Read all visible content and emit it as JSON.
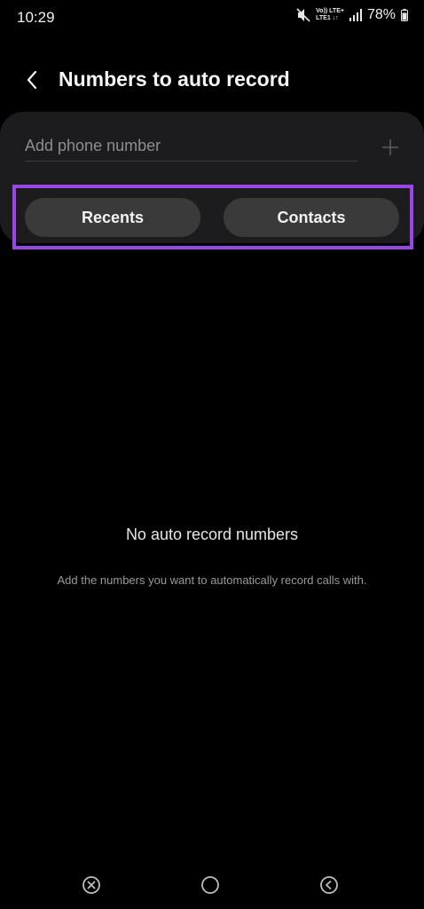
{
  "status_bar": {
    "time": "10:29",
    "network_top": "Vo)) LTE+",
    "network_bottom": "LTE1 ↓↑",
    "battery": "78%",
    "icons": [
      "mute-icon",
      "signal-icon",
      "battery-icon"
    ]
  },
  "header": {
    "title": "Numbers to auto record",
    "back_icon": "chevron-left-icon"
  },
  "card": {
    "phone_placeholder": "Add phone number",
    "phone_value": "",
    "add_icon": "plus-icon",
    "recents_label": "Recents",
    "contacts_label": "Contacts",
    "highlight_color": "#9a45e6"
  },
  "empty_state": {
    "title": "No auto record numbers",
    "description": "Add the numbers you want to automatically record calls with."
  },
  "nav_bar": {
    "icons": [
      "recent-apps-icon",
      "home-icon",
      "back-icon"
    ]
  }
}
